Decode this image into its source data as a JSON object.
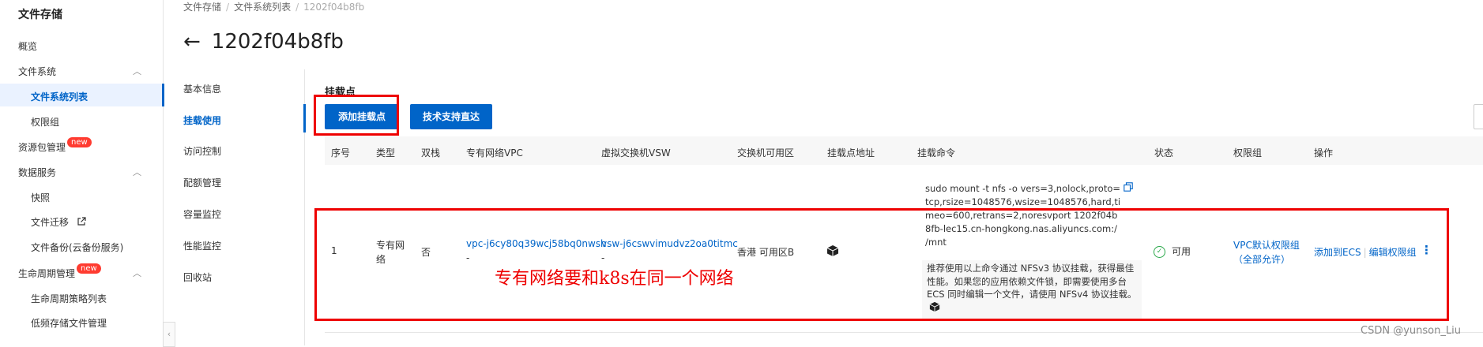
{
  "sidebar": {
    "title": "文件存储",
    "items": [
      {
        "label": "概览"
      },
      {
        "label": "文件系统"
      },
      {
        "label": "文件系统列表"
      },
      {
        "label": "权限组"
      },
      {
        "label": "资源包管理",
        "badge": "new"
      },
      {
        "label": "数据服务"
      },
      {
        "label": "快照"
      },
      {
        "label": "文件迁移"
      },
      {
        "label": "文件备份(云备份服务)"
      },
      {
        "label": "生命周期管理",
        "badge": "new"
      },
      {
        "label": "生命周期策略列表"
      },
      {
        "label": "低频存储文件管理"
      }
    ]
  },
  "breadcrumb": {
    "items": [
      "文件存储",
      "文件系统列表",
      "1202f04b8fb"
    ]
  },
  "page": {
    "title": "1202f04b8fb"
  },
  "subnav": {
    "items": [
      "基本信息",
      "挂载使用",
      "访问控制",
      "配额管理",
      "容量监控",
      "性能监控",
      "回收站"
    ],
    "active": "挂载使用"
  },
  "content": {
    "section_title": "挂载点",
    "add_button": "添加挂载点",
    "support_button": "技术支持直达",
    "columns": [
      "序号",
      "类型",
      "双栈",
      "专有网络VPC",
      "虚拟交换机VSW",
      "交换机可用区",
      "挂载点地址",
      "挂载命令",
      "状态",
      "权限组",
      "操作"
    ],
    "row": {
      "index": "1",
      "type_line1": "专有网",
      "type_line2": "络",
      "dual_stack": "否",
      "vpc": "vpc-j6cy80q39wcj58bq0nwsh",
      "vpc_dash": "-",
      "vsw": "vsw-j6cswvimudvz2oa0titmc",
      "vsw_dash": "-",
      "zone": "香港 可用区B",
      "mount_command": "sudo mount -t nfs -o vers=3,nolock,proto=tcp,rsize=1048576,wsize=1048576,hard,timeo=600,retrans=2,noresvport 1202f04b8fb-lec15.cn-hongkong.nas.aliyuncs.com:/ /mnt",
      "mount_tip": "推荐使用以上命令通过 NFSv3 协议挂载，获得最佳性能。如果您的应用依赖文件锁，即需要使用多台 ECS 同时编辑一个文件，请使用 NFSv4 协议挂载。",
      "status": "可用",
      "permission_group_line1": "VPC默认权限组",
      "permission_group_line2": "（全部允许）",
      "action_add_ecs": "添加到ECS",
      "action_edit_group": "编辑权限组"
    }
  },
  "annotation": {
    "text": "专有网络要和k8s在同一个网络"
  },
  "watermark": {
    "text": "CSDN @yunson_Liu"
  },
  "colors": {
    "primary": "#0064c8",
    "annotation_red": "#e00000",
    "status_ok": "#2aa84a"
  }
}
